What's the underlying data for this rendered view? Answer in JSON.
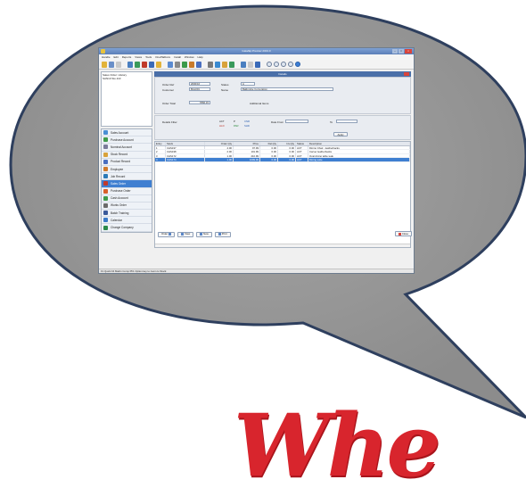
{
  "window": {
    "title": "Gaia/Ep  Premier 2013.0",
    "menu": [
      "Handle",
      "Edit",
      "Reports",
      "Views",
      "Tools",
      "OnePlaDocs",
      "Install",
      "Window",
      "Help"
    ]
  },
  "nav_panel": {
    "title": "Sales Order: History",
    "items": [
      "SAN10 Sto.110"
    ]
  },
  "modules": [
    {
      "label": "Sales Account",
      "icon": "sales-account-icon",
      "color": "#4a8fd4"
    },
    {
      "label": "Purchase Account",
      "icon": "purchase-account-icon",
      "color": "#3f9a4a"
    },
    {
      "label": "Nominal Account",
      "icon": "nominal-account-icon",
      "color": "#7a7a9a"
    },
    {
      "label": "Stock Record",
      "icon": "stock-record-icon",
      "color": "#d8a23a"
    },
    {
      "label": "Product Record",
      "icon": "product-record-icon",
      "color": "#4a6fc0"
    },
    {
      "label": "Employee",
      "icon": "employee-icon",
      "color": "#d07a2a"
    },
    {
      "label": "Job Record",
      "icon": "job-record-icon",
      "color": "#2a7ab8"
    },
    {
      "label": "Sales Order",
      "icon": "sales-order-icon",
      "color": "#c23a2c",
      "selected": true
    },
    {
      "label": "Purchase Order",
      "icon": "purchase-order-icon",
      "color": "#d8602a"
    },
    {
      "label": "Cash Account",
      "icon": "cash-account-icon",
      "color": "#3f9a4a"
    },
    {
      "label": "Works Order",
      "icon": "works-order-icon",
      "color": "#6a6a6a"
    },
    {
      "label": "Batch Training",
      "icon": "batch-training-icon",
      "color": "#3a5a9a"
    },
    {
      "label": "Calendar",
      "icon": "calendar-icon",
      "color": "#3a7ac8"
    },
    {
      "label": "Change Company",
      "icon": "change-company-icon",
      "color": "#2a8a4a"
    }
  ],
  "details": {
    "header": "Details",
    "order_ref_label": "Order Ref",
    "order_ref": "2000/16",
    "customer_label": "Customer",
    "customer": "BAL001",
    "status_label": "Status",
    "status": "A",
    "name_label": "Name",
    "name": "Ballinrobe Corporation",
    "order_total_label": "Order Total",
    "order_total": "7866.15",
    "additional_items_label": "Additional Items"
  },
  "filter": {
    "label": "Details Filter",
    "checks": [
      "ACT",
      "P",
      "CNR",
      "HLD",
      "PAR",
      "SHD"
    ],
    "date_from_label": "Date From",
    "to_label": "To",
    "apply_label": "Apply"
  },
  "grid": {
    "columns": [
      "Entry",
      "Stock",
      "Order Qty",
      "Price",
      "Del.Qty",
      "Inv.Qty",
      "Status",
      "Description"
    ],
    "rows": [
      [
        "1",
        "CHS197",
        "4.00",
        "97.99",
        "0.00",
        "0.00",
        "ACT",
        "Dining Chair - leatherbacks"
      ],
      [
        "2",
        "CHS198",
        "2.00",
        "101.99",
        "0.00",
        "0.00",
        "ACT",
        "Carver leatherbacks"
      ],
      [
        "3",
        "CHS172",
        "1.00",
        "210.99",
        "0.00",
        "0.00",
        "ACT",
        "Oval dining table teak"
      ],
      [
        "4",
        "CHS174",
        "1.00",
        "1099.99",
        "0.00",
        "0.00",
        "ACT",
        "Dining suite"
      ]
    ]
  },
  "bottom_buttons": {
    "order": "Order",
    "view": "View",
    "new": "New",
    "print": "Print",
    "close": "Close"
  },
  "statusbar": "F1 Quick  F4 Matrix  Comp Ph1  Option key to zoom to Stock",
  "wordmark": "Whe"
}
